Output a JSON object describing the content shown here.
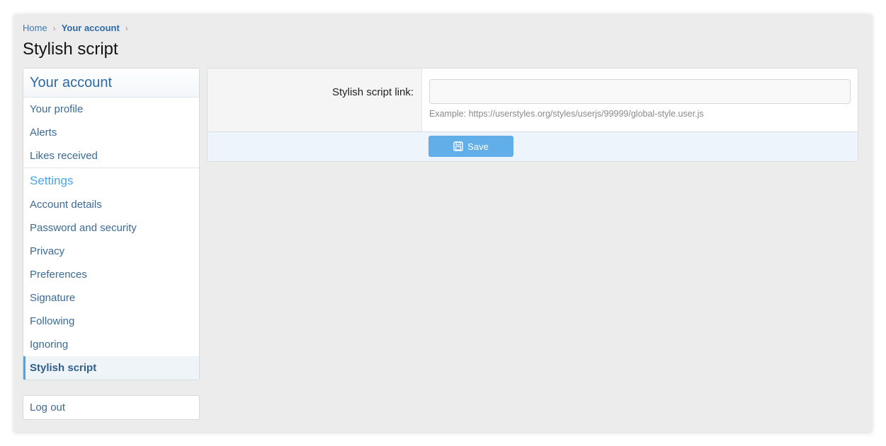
{
  "breadcrumb": {
    "items": [
      "Home",
      "Your account"
    ]
  },
  "page": {
    "title": "Stylish script"
  },
  "sidebar": {
    "header": "Your account",
    "account_items": [
      {
        "label": "Your profile"
      },
      {
        "label": "Alerts"
      },
      {
        "label": "Likes received"
      }
    ],
    "settings_header": "Settings",
    "settings_items": [
      {
        "label": "Account details"
      },
      {
        "label": "Password and security"
      },
      {
        "label": "Privacy"
      },
      {
        "label": "Preferences"
      },
      {
        "label": "Signature"
      },
      {
        "label": "Following"
      },
      {
        "label": "Ignoring"
      },
      {
        "label": "Stylish script",
        "selected": true
      }
    ],
    "logout_label": "Log out"
  },
  "form": {
    "field_label": "Stylish script link:",
    "field_value": "",
    "hint": "Example: https://userstyles.org/styles/userjs/99999/global-style.user.js",
    "save_label": "Save",
    "save_icon": "floppy-disk-icon"
  },
  "colors": {
    "accent": "#47a7eb",
    "link": "#3b6a95",
    "button": "#62aee8"
  }
}
